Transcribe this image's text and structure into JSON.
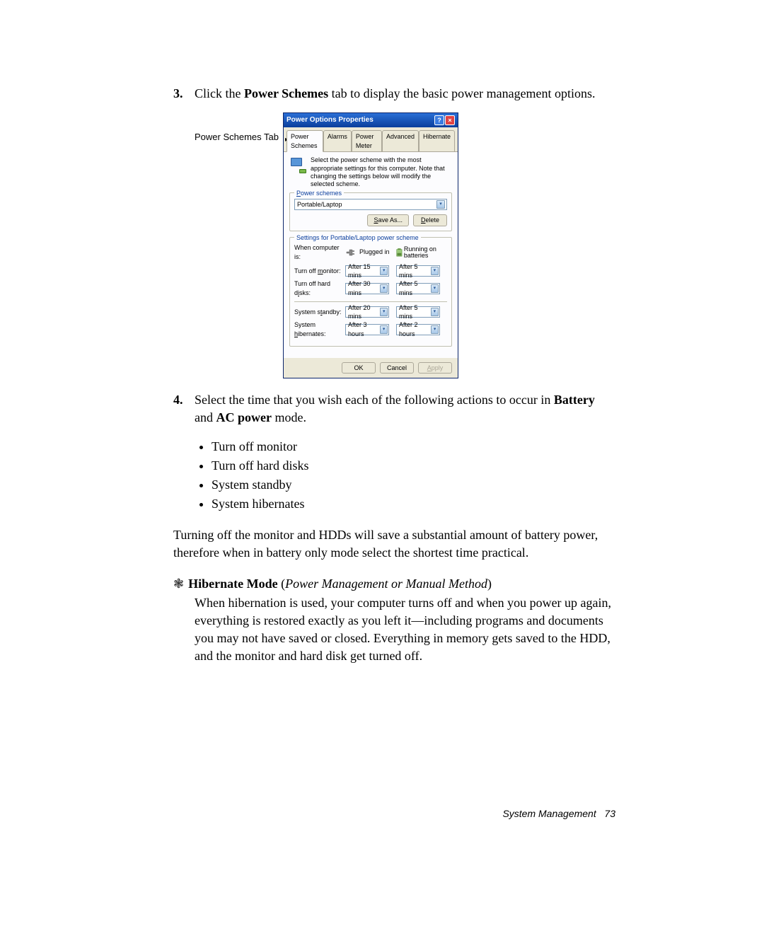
{
  "step3": {
    "num": "3.",
    "pre": "Click the ",
    "bold": "Power Schemes",
    "post": " tab to display the basic power management options."
  },
  "callout_label": "Power Schemes Tab",
  "dialog": {
    "title": "Power Options Properties",
    "tabs": [
      "Power Schemes",
      "Alarms",
      "Power Meter",
      "Advanced",
      "Hibernate"
    ],
    "intro": "Select the power scheme with the most appropriate settings for this computer. Note that changing the settings below will modify the selected scheme.",
    "group1": {
      "legend_pre": "P",
      "legend_post": "ower schemes",
      "selected": "Portable/Laptop",
      "save_pre": "S",
      "save_post": "ave As...",
      "delete_pre": "D",
      "delete_post": "elete"
    },
    "group2": {
      "legend": "Settings for Portable/Laptop power scheme",
      "when_label": "When computer is:",
      "plugged": "Plugged in",
      "battery": "Running on batteries",
      "rows": [
        {
          "label_pre": "Turn off ",
          "label_u": "m",
          "label_post": "onitor:",
          "p": "After 15 mins",
          "b": "After 5 mins"
        },
        {
          "label_pre": "Turn off hard d",
          "label_u": "i",
          "label_post": "sks:",
          "p": "After 30 mins",
          "b": "After 5 mins"
        }
      ],
      "rows2": [
        {
          "label_pre": "System s",
          "label_u": "t",
          "label_post": "andby:",
          "p": "After 20 mins",
          "b": "After 5 mins"
        },
        {
          "label_pre": "System ",
          "label_u": "h",
          "label_post": "ibernates:",
          "p": "After 3 hours",
          "b": "After 2 hours"
        }
      ]
    },
    "footer": {
      "ok": "OK",
      "cancel": "Cancel",
      "apply_pre": "A",
      "apply_post": "pply"
    }
  },
  "step4": {
    "num": "4.",
    "pre": "Select the time that you wish each of the following actions to occur in ",
    "bold1": "Battery",
    "mid": " and ",
    "bold2": "AC power",
    "post": " mode.",
    "bullets": [
      "Turn off monitor",
      "Turn off hard disks",
      "System standby",
      "System hibernates"
    ]
  },
  "paragraph": "Turning off the monitor and HDDs will save a substantial amount of battery power, therefore when in battery only mode select the shortest time practical.",
  "hibernate": {
    "title_bold": "Hibernate Mode",
    "title_italic_pre": " (",
    "title_italic": "Power Management or Manual Method",
    "title_italic_post": ")",
    "body": "When hibernation is used, your computer turns off and when you power up again, everything is restored exactly as you left it—including programs and documents you may not have saved or closed. Everything in memory gets saved to the HDD, and the monitor and hard disk get turned off."
  },
  "footer": {
    "text": "System Management",
    "page": "73"
  }
}
